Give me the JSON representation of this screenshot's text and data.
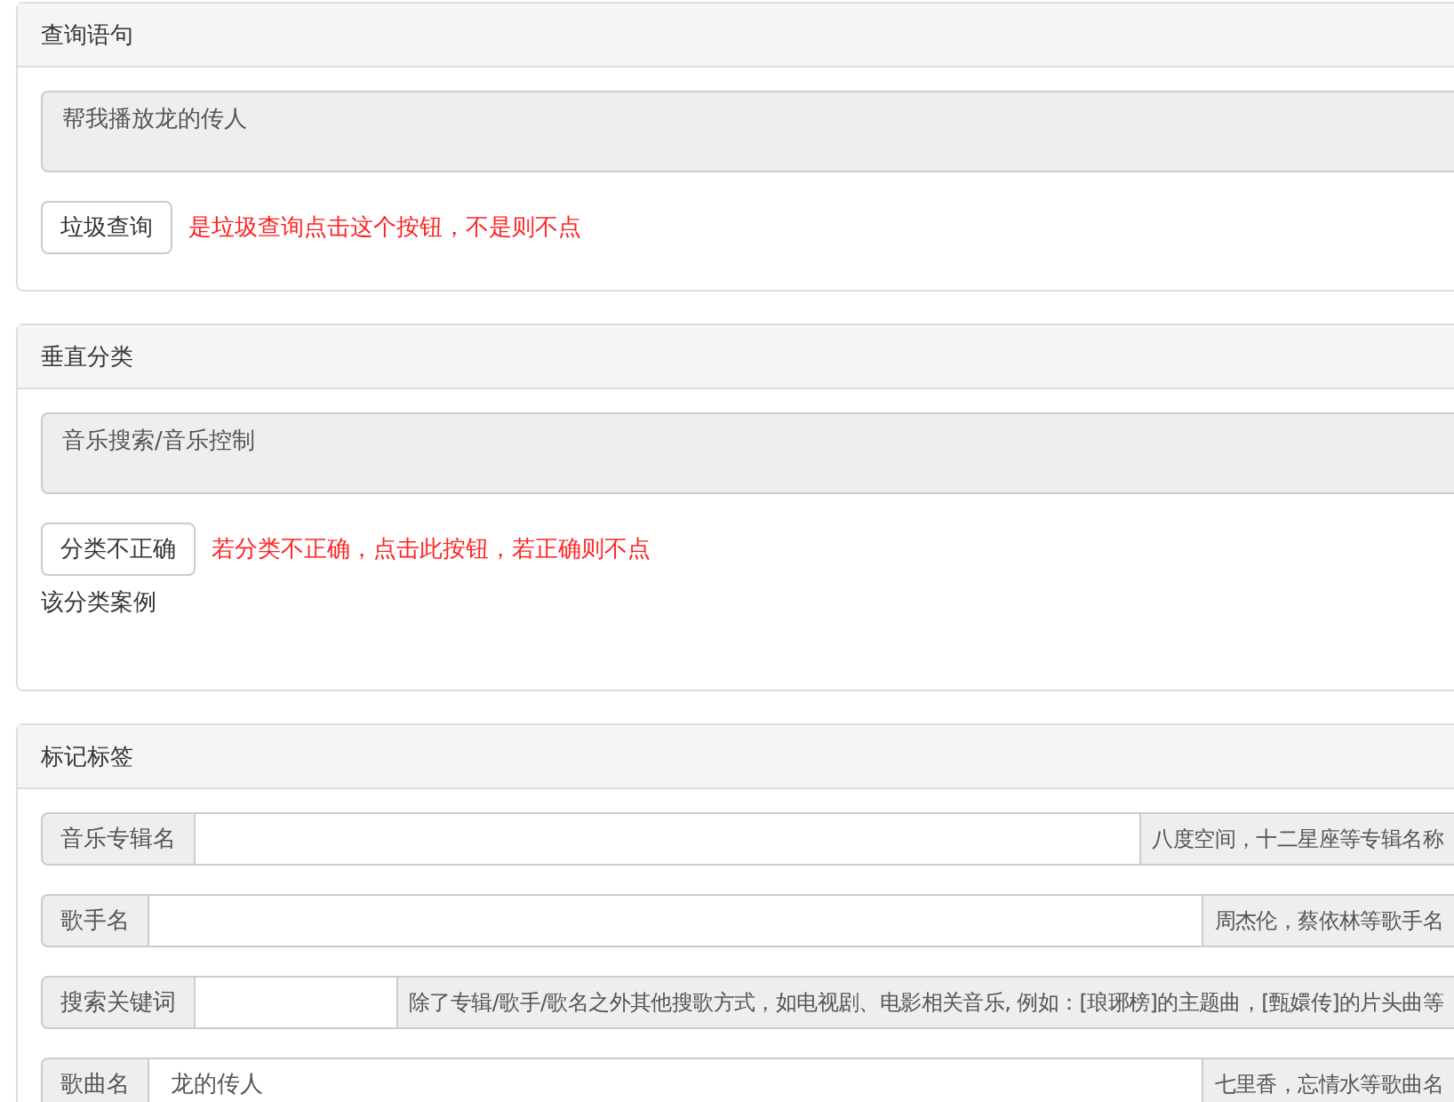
{
  "query_panel": {
    "title": "查询语句",
    "query": "帮我播放龙的传人",
    "button": "垃圾查询",
    "hint": "是垃圾查询点击这个按钮，不是则不点"
  },
  "category_panel": {
    "title": "垂直分类",
    "category": "音乐搜索/音乐控制",
    "button": "分类不正确",
    "hint": "若分类不正确，点击此按钮，若正确则不点",
    "examples_label": "该分类案例"
  },
  "tags_panel": {
    "title": "标记标签",
    "fields": [
      {
        "label": "音乐专辑名",
        "hint": "八度空间，十二星座等专辑名称"
      },
      {
        "label": "歌手名",
        "hint": "周杰伦，蔡依林等歌手名"
      },
      {
        "label": "搜索关键词",
        "hint": "除了专辑/歌手/歌名之外其他搜歌方式，如电视剧、电影相关音乐, 例如：[琅琊榜]的主题曲，[甄嬛传]的片头曲等"
      },
      {
        "label": "歌曲名",
        "value": "龙的传人",
        "hint": "七里香，忘情水等歌曲名"
      }
    ]
  }
}
